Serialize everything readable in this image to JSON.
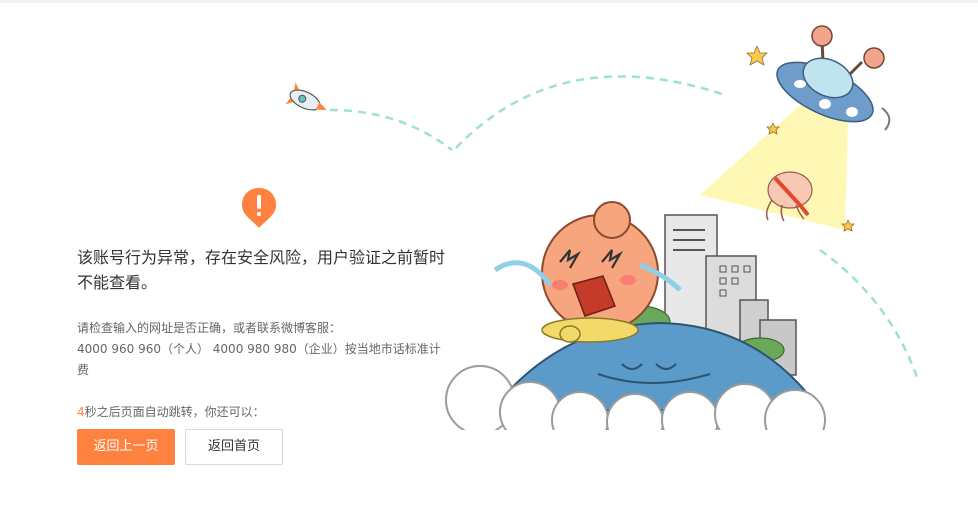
{
  "message": {
    "title": "该账号行为异常，存在安全风险，用户验证之前暂时不能查看。",
    "hint_intro": "请检查输入的网址是否正确，或者联系微博客服：",
    "hint_phone": "4000 960 960（个人） 4000 980 980（企业）按当地市话标准计",
    "hint_tail": "费",
    "countdown": "4",
    "redirect_text": "秒之后页面自动跳转，你还可以："
  },
  "buttons": {
    "back_label": "返回上一页",
    "home_label": "返回首页"
  },
  "colors": {
    "accent": "#ff8140",
    "dash": "#9fe0d4",
    "planet": "#5b9bc9"
  },
  "icons": {
    "alert": "exclamation-pin-icon",
    "rocket": "rocket-icon",
    "ufo": "ufo-icon"
  }
}
